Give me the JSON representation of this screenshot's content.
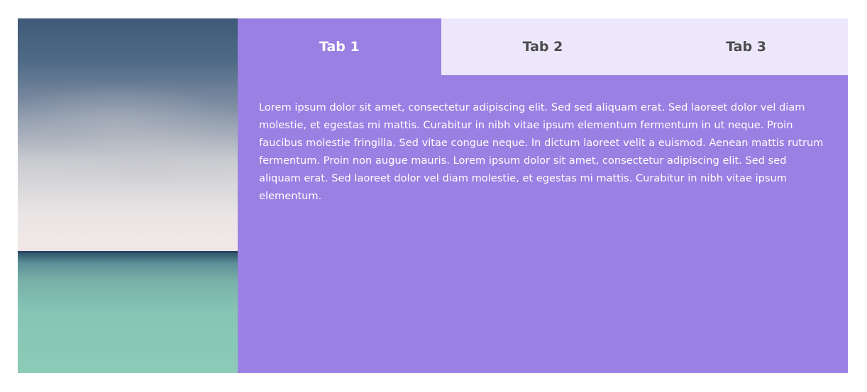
{
  "tabs": [
    {
      "label": "Tab 1",
      "active": true
    },
    {
      "label": "Tab 2",
      "active": false
    },
    {
      "label": "Tab 3",
      "active": false
    }
  ],
  "content": {
    "text": "Lorem ipsum dolor sit amet, consectetur adipiscing elit. Sed sed aliquam erat. Sed laoreet dolor vel diam molestie, et egestas mi mattis. Curabitur in nibh vitae ipsum elementum fermentum in ut neque. Proin faucibus molestie fringilla. Sed vitae congue neque. In dictum laoreet velit a euismod. Aenean mattis rutrum fermentum. Proin non augue mauris. Lorem ipsum dolor sit amet, consectetur adipiscing elit. Sed sed aliquam erat. Sed laoreet dolor vel diam molestie, et egestas mi mattis. Curabitur in nibh vitae ipsum elementum."
  },
  "colors": {
    "panel": "#9a80e2",
    "tab_inactive": "#ede7fb",
    "tab_inactive_text": "#4a4a4a",
    "active_text": "#ffffff"
  }
}
